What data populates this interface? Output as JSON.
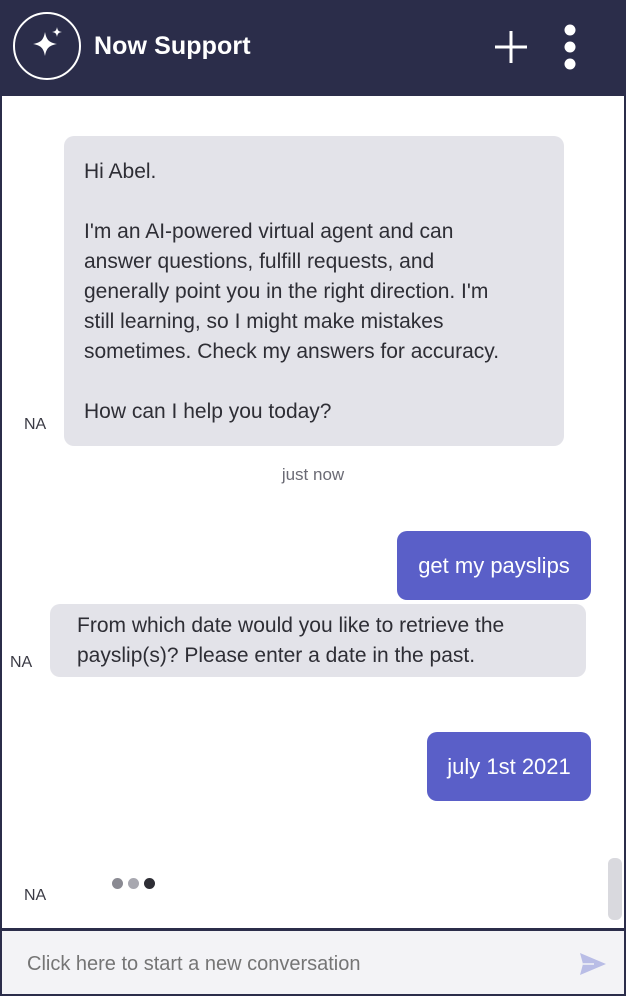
{
  "header": {
    "title": "Now Support",
    "logo_icon": "sparkle-icon",
    "new_chat_icon": "plus-icon",
    "menu_icon": "more-vertical-icon",
    "background_color": "#2b2d4a"
  },
  "messages": [
    {
      "sender": "bot",
      "avatar": "NA",
      "lines": [
        "Hi Abel.",
        "",
        "I'm an AI-powered virtual agent and can",
        "answer questions, fulfill requests, and",
        "generally point you in the right direction. I'm",
        "still learning, so I might make mistakes",
        "sometimes. Check my answers for accuracy.",
        "",
        "How can I help you today?"
      ]
    },
    {
      "timestamp": "just now"
    },
    {
      "sender": "user",
      "text": "get my payslips"
    },
    {
      "sender": "bot",
      "avatar": "NA",
      "lines": [
        "From which date would you like to retrieve the",
        "payslip(s)? Please enter a date in the past."
      ]
    },
    {
      "sender": "user",
      "text": "july 1st 2021"
    },
    {
      "sender": "bot",
      "avatar": "NA",
      "typing": true
    }
  ],
  "composer": {
    "placeholder": "Click here to start a new conversation",
    "send_icon": "send-icon"
  },
  "colors": {
    "user_bubble": "#5a5fc8",
    "bot_bubble": "#e3e3e9",
    "accent": "#2b2d4a"
  }
}
